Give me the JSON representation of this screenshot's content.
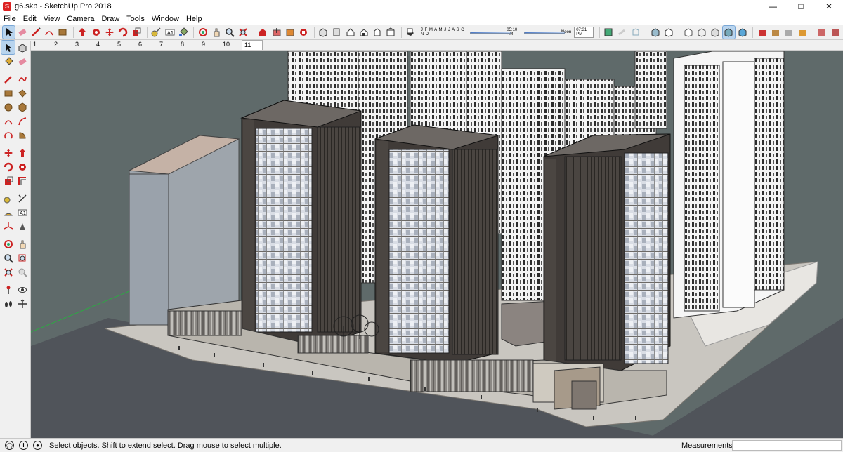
{
  "window": {
    "title": "g6.skp - SketchUp Pro 2018",
    "app_icon": "sketchup-logo-icon",
    "controls": [
      "minimize-icon",
      "maximize-icon",
      "close-icon"
    ]
  },
  "menu": [
    "File",
    "Edit",
    "View",
    "Camera",
    "Draw",
    "Tools",
    "Window",
    "Help"
  ],
  "toolbar": {
    "shadows": {
      "months": "J F M A M J J A S O N D",
      "sunrise_time": "05:10 AM",
      "noon_label": "Noon",
      "sunset_time": "07:31 PM"
    }
  },
  "scenes": {
    "tabs": [
      "1",
      "2",
      "3",
      "4",
      "5",
      "6",
      "7",
      "8",
      "9",
      "10",
      "11"
    ],
    "active": "11"
  },
  "status": {
    "hint": "Select objects. Shift to extend select. Drag mouse to select multiple.",
    "measurements_label": "Measurements",
    "measurements_value": ""
  },
  "colors": {
    "viewport_bg": "#5f6a6a",
    "road": "#50545a",
    "ground": "#c9c6c0",
    "tower_frame": "#3f3b38",
    "glass": "#d8dde6",
    "selection": "#b8d4ee"
  }
}
